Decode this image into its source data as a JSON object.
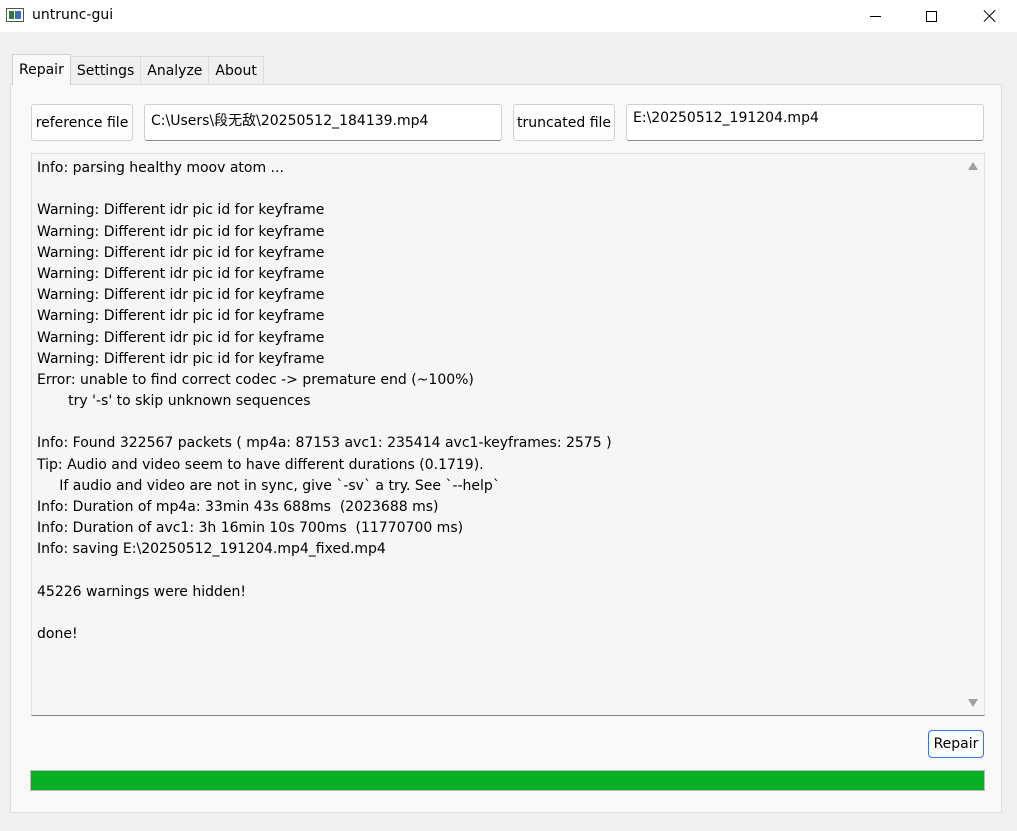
{
  "window": {
    "title": "untrunc-gui"
  },
  "tabs": [
    {
      "label": "Repair",
      "active": true
    },
    {
      "label": "Settings",
      "active": false
    },
    {
      "label": "Analyze",
      "active": false
    },
    {
      "label": "About",
      "active": false
    }
  ],
  "repair": {
    "reference_button": "reference file",
    "reference_path": "C:\\Users\\段无敌\\20250512_184139.mp4",
    "truncated_button": "truncated file",
    "truncated_path": "E:\\20250512_191204.mp4",
    "repair_button": "Repair",
    "progress_percent": 100,
    "progress_color": "#06b025"
  },
  "log_lines": [
    "Info: parsing healthy moov atom ...",
    "",
    "Warning: Different idr pic id for keyframe",
    "Warning: Different idr pic id for keyframe",
    "Warning: Different idr pic id for keyframe",
    "Warning: Different idr pic id for keyframe",
    "Warning: Different idr pic id for keyframe",
    "Warning: Different idr pic id for keyframe",
    "Warning: Different idr pic id for keyframe",
    "Warning: Different idr pic id for keyframe",
    "Error: unable to find correct codec -> premature end (~100%)",
    "       try '-s' to skip unknown sequences",
    "",
    "Info: Found 322567 packets ( mp4a: 87153 avc1: 235414 avc1-keyframes: 2575 )",
    "Tip: Audio and video seem to have different durations (0.1719).",
    "     If audio and video are not in sync, give `-sv` a try. See `--help`",
    "Info: Duration of mp4a: 33min 43s 688ms  (2023688 ms)",
    "Info: Duration of avc1: 3h 16min 10s 700ms  (11770700 ms)",
    "Info: saving E:\\20250512_191204.mp4_fixed.mp4",
    "",
    "45226 warnings were hidden!",
    "",
    "done!"
  ]
}
